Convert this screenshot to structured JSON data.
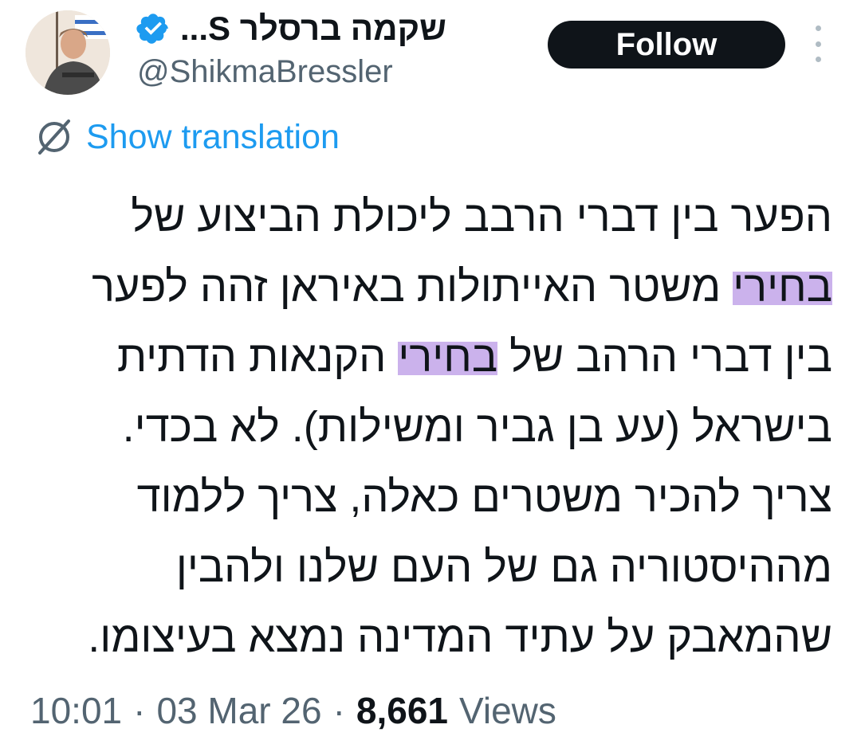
{
  "author": {
    "display_name": "שקמה ברסלר S...",
    "handle": "@ShikmaBressler",
    "verified": true
  },
  "actions": {
    "follow_label": "Follow"
  },
  "translation": {
    "label": "Show translation"
  },
  "tweet": {
    "lines": [
      {
        "parts": [
          "הפער בין דברי הרבב ליכולת הביצוע של"
        ]
      },
      {
        "highlight": "בחירי",
        "rest": " משטר האייתולות באיראן זהה לפער"
      },
      {
        "before": "בין דברי הרהב של ",
        "highlight": "בחירי",
        "after": " הקנאות הדתית"
      },
      {
        "parts": [
          "בישראל (עע בן גביר ומשילות). לא בכדי."
        ]
      },
      {
        "parts": [
          "צריך להכיר משטרים כאלה, צריך ללמוד"
        ]
      },
      {
        "parts": [
          "מההיסטוריה גם של העם שלנו ולהבין"
        ]
      },
      {
        "parts": [
          "שהמאבק על עתיד המדינה נמצא בעיצומו."
        ]
      }
    ]
  },
  "meta": {
    "time": "10:01",
    "separator": "·",
    "date": "03 Mar 26",
    "views_count": "8,661",
    "views_label": "Views"
  },
  "colors": {
    "link": "#1d9bf0",
    "text": "#0f1419",
    "secondary": "#536471",
    "highlight": "#cbb2ec",
    "verified": "#1d9bf0"
  },
  "icons": {
    "verified": "verified-badge-icon",
    "translate": "globe-slash-icon",
    "more": "more-vertical-icon"
  }
}
